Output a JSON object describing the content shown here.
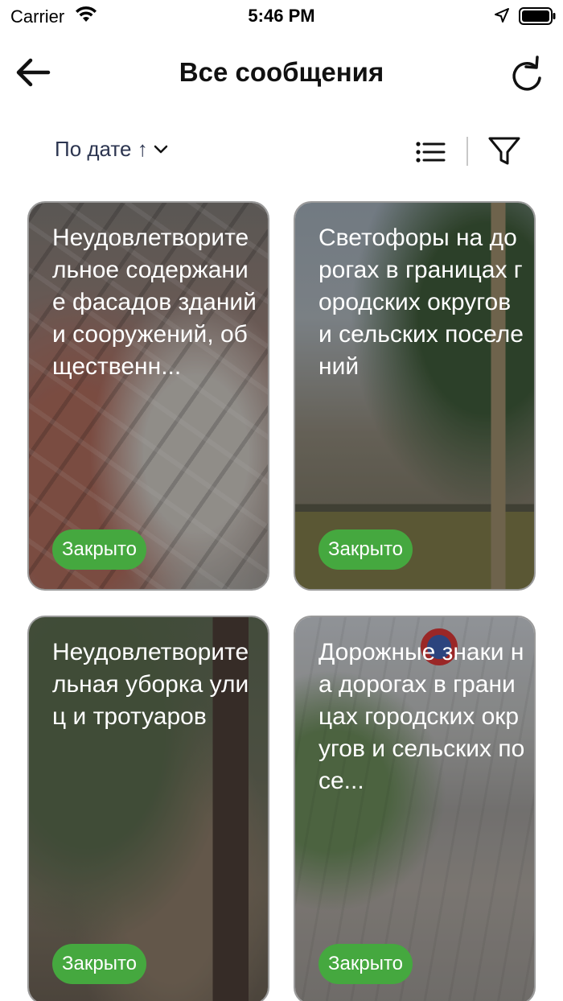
{
  "status_bar": {
    "carrier": "Carrier",
    "time": "5:46 PM"
  },
  "nav": {
    "title": "Все сообщения"
  },
  "toolbar": {
    "sort_label": "По дате ↑"
  },
  "cards": [
    {
      "title": "Неудовлетворительное содержание фасадов зданий и сооружений, общественн...",
      "status": "Закрыто"
    },
    {
      "title": "Светофоры на дорогах в границах городских округов и сельских поселений",
      "status": "Закрыто"
    },
    {
      "title": "Неудовлетворительная уборка улиц и тротуаров",
      "status": "Закрыто"
    },
    {
      "title": "Дорожные знаки на дорогах в границах городских округов и сельских посе...",
      "status": "Закрыто"
    }
  ],
  "colors": {
    "status_closed": "#45a83f",
    "sort_text": "#2c3550"
  },
  "icons": [
    "wifi-icon",
    "location-arrow-icon",
    "battery-icon",
    "back-arrow-icon",
    "refresh-icon",
    "chevron-down-icon",
    "list-view-icon",
    "filter-icon"
  ]
}
